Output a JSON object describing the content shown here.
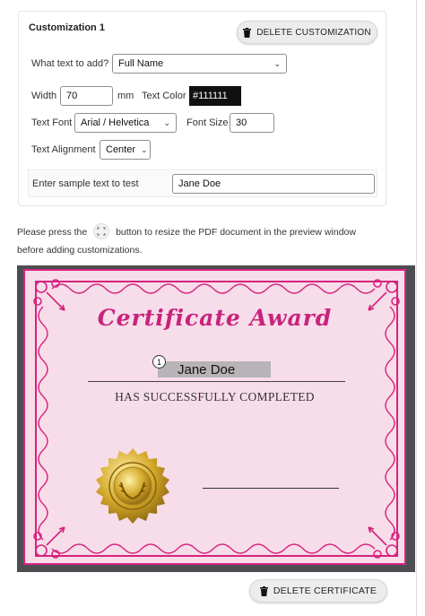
{
  "customization": {
    "title": "Customization 1",
    "delete_button": "DELETE CUSTOMIZATION",
    "text_to_add_label": "What text to add?",
    "text_to_add_value": "Full Name",
    "width_label": "Width",
    "width_value": "70",
    "width_unit": "mm",
    "text_color_label": "Text Color",
    "text_color_value": "#111111",
    "text_font_label": "Text Font",
    "text_font_value": "Arial / Helvetica",
    "font_size_label": "Font Size",
    "font_size_value": "30",
    "alignment_label": "Text Alignment",
    "alignment_value": "Center",
    "sample_label": "Enter sample text to test",
    "sample_value": "Jane Doe"
  },
  "info": {
    "part1": "Please press the",
    "part2": "button to resize the PDF document in the preview window",
    "line2": "before adding customizations."
  },
  "preview": {
    "certificate_title": "Certificate Award",
    "marker_number": "1",
    "sample_name": "Jane Doe",
    "completed_text": "HAS SUCCESSFULLY COMPLETED"
  },
  "footer": {
    "delete_certificate": "DELETE CERTIFICATE"
  },
  "colors": {
    "accent_pink": "#d6237f",
    "certificate_bg": "#f7dde9",
    "preview_bg": "#4e4e52",
    "seal_gold": "#d4a82a"
  },
  "icons": [
    "trash-icon",
    "resize-icon",
    "chevron-down-icon",
    "gold-seal-icon"
  ]
}
